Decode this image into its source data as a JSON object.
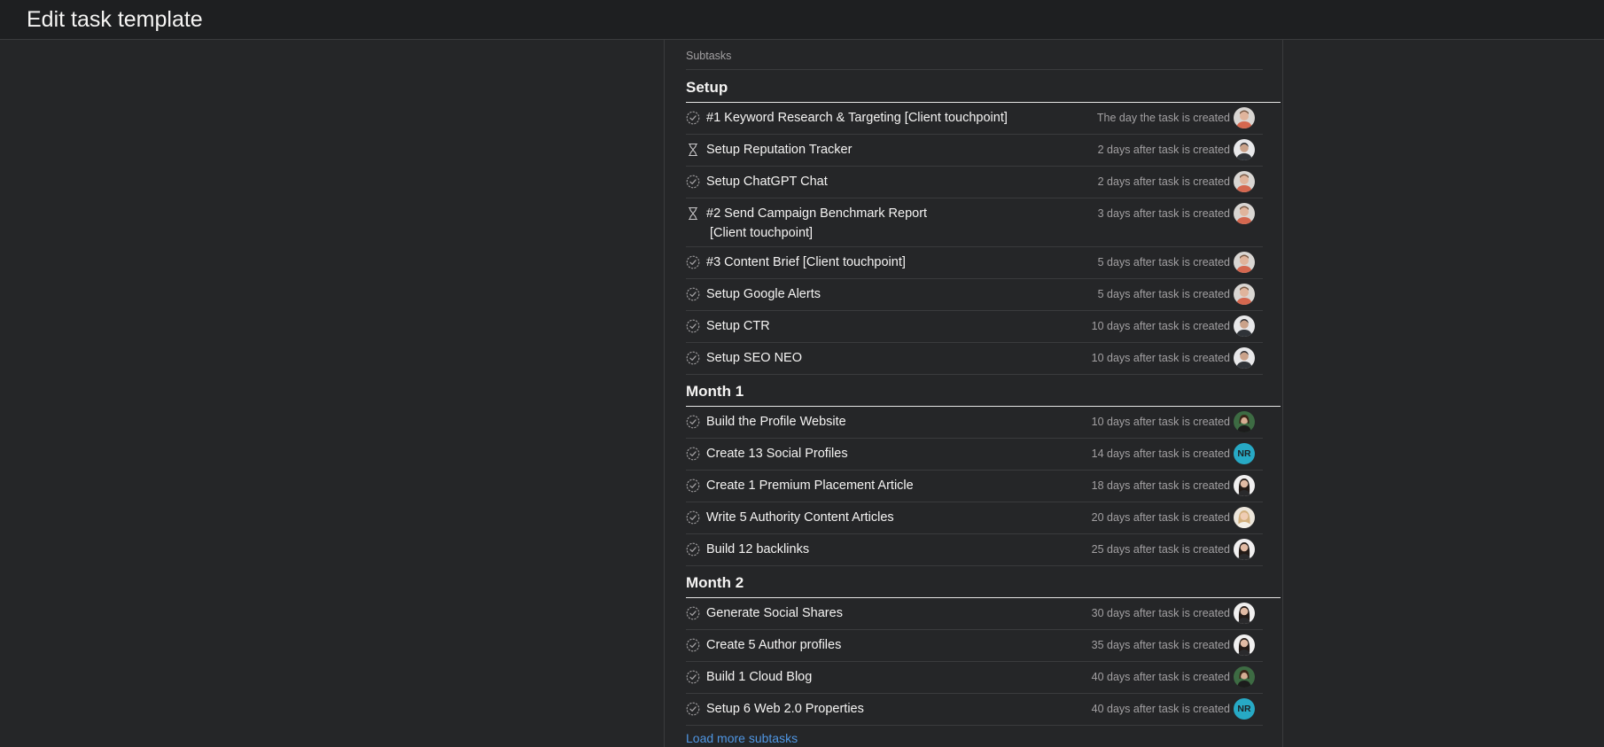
{
  "header": {
    "title": "Edit task template"
  },
  "subtasks": {
    "label": "Subtasks",
    "load_more_label": "Load more subtasks",
    "sections": [
      {
        "title": "Setup",
        "tasks": [
          {
            "name": "#1 Keyword Research & Targeting [Client touchpoint]",
            "due": "The day the task is created",
            "status": "check-circle-icon",
            "assignee": "avatar-man-a"
          },
          {
            "name": "Setup Reputation Tracker",
            "due": "2 days after task is created",
            "status": "hourglass-icon",
            "assignee": "avatar-man-b"
          },
          {
            "name": "Setup ChatGPT Chat",
            "due": "2 days after task is created",
            "status": "check-circle-icon",
            "assignee": "avatar-man-a"
          },
          {
            "name": "#2 Send Campaign Benchmark Report\n[Client touchpoint]",
            "due": "3 days after task is created",
            "status": "hourglass-icon",
            "assignee": "avatar-man-a"
          },
          {
            "name": "#3 Content Brief [Client touchpoint]",
            "due": "5 days after task is created",
            "status": "check-circle-icon",
            "assignee": "avatar-man-a"
          },
          {
            "name": "Setup Google Alerts",
            "due": "5 days after task is created",
            "status": "check-circle-icon",
            "assignee": "avatar-man-a"
          },
          {
            "name": "Setup CTR",
            "due": "10 days after task is created",
            "status": "check-circle-icon",
            "assignee": "avatar-man-b"
          },
          {
            "name": "Setup SEO NEO",
            "due": "10 days after task is created",
            "status": "check-circle-icon",
            "assignee": "avatar-man-b"
          }
        ]
      },
      {
        "title": "Month 1",
        "tasks": [
          {
            "name": "Build the Profile Website",
            "due": "10 days after task is created",
            "status": "check-circle-icon",
            "assignee": "avatar-woman-green"
          },
          {
            "name": "Create 13 Social Profiles",
            "due": "14 days after task is created",
            "status": "check-circle-icon",
            "assignee": "NR"
          },
          {
            "name": "Create 1 Premium Placement Article",
            "due": "18 days after task is created",
            "status": "check-circle-icon",
            "assignee": "avatar-woman-dark"
          },
          {
            "name": "Write 5 Authority Content Articles",
            "due": "20 days after task is created",
            "status": "check-circle-icon",
            "assignee": "avatar-woman-blonde"
          },
          {
            "name": "Build 12 backlinks",
            "due": "25 days after task is created",
            "status": "check-circle-icon",
            "assignee": "avatar-woman-dark"
          }
        ]
      },
      {
        "title": "Month 2",
        "tasks": [
          {
            "name": "Generate Social Shares",
            "due": "30 days after task is created",
            "status": "check-circle-icon",
            "assignee": "avatar-woman-dark"
          },
          {
            "name": "Create 5 Author profiles",
            "due": "35 days after task is created",
            "status": "check-circle-icon",
            "assignee": "avatar-woman-dark"
          },
          {
            "name": "Build 1 Cloud Blog",
            "due": "40 days after task is created",
            "status": "check-circle-icon",
            "assignee": "avatar-woman-green"
          },
          {
            "name": "Setup 6 Web 2.0 Properties",
            "due": "40 days after task is created",
            "status": "check-circle-icon",
            "assignee": "NR"
          }
        ]
      }
    ]
  },
  "colors": {
    "background": "#252628",
    "header_bg": "#1e1f21",
    "divider": "#3a3b3d",
    "muted_text": "#a2a0a2",
    "link": "#4f96e3",
    "initials_avatar": "#27a9c5"
  }
}
